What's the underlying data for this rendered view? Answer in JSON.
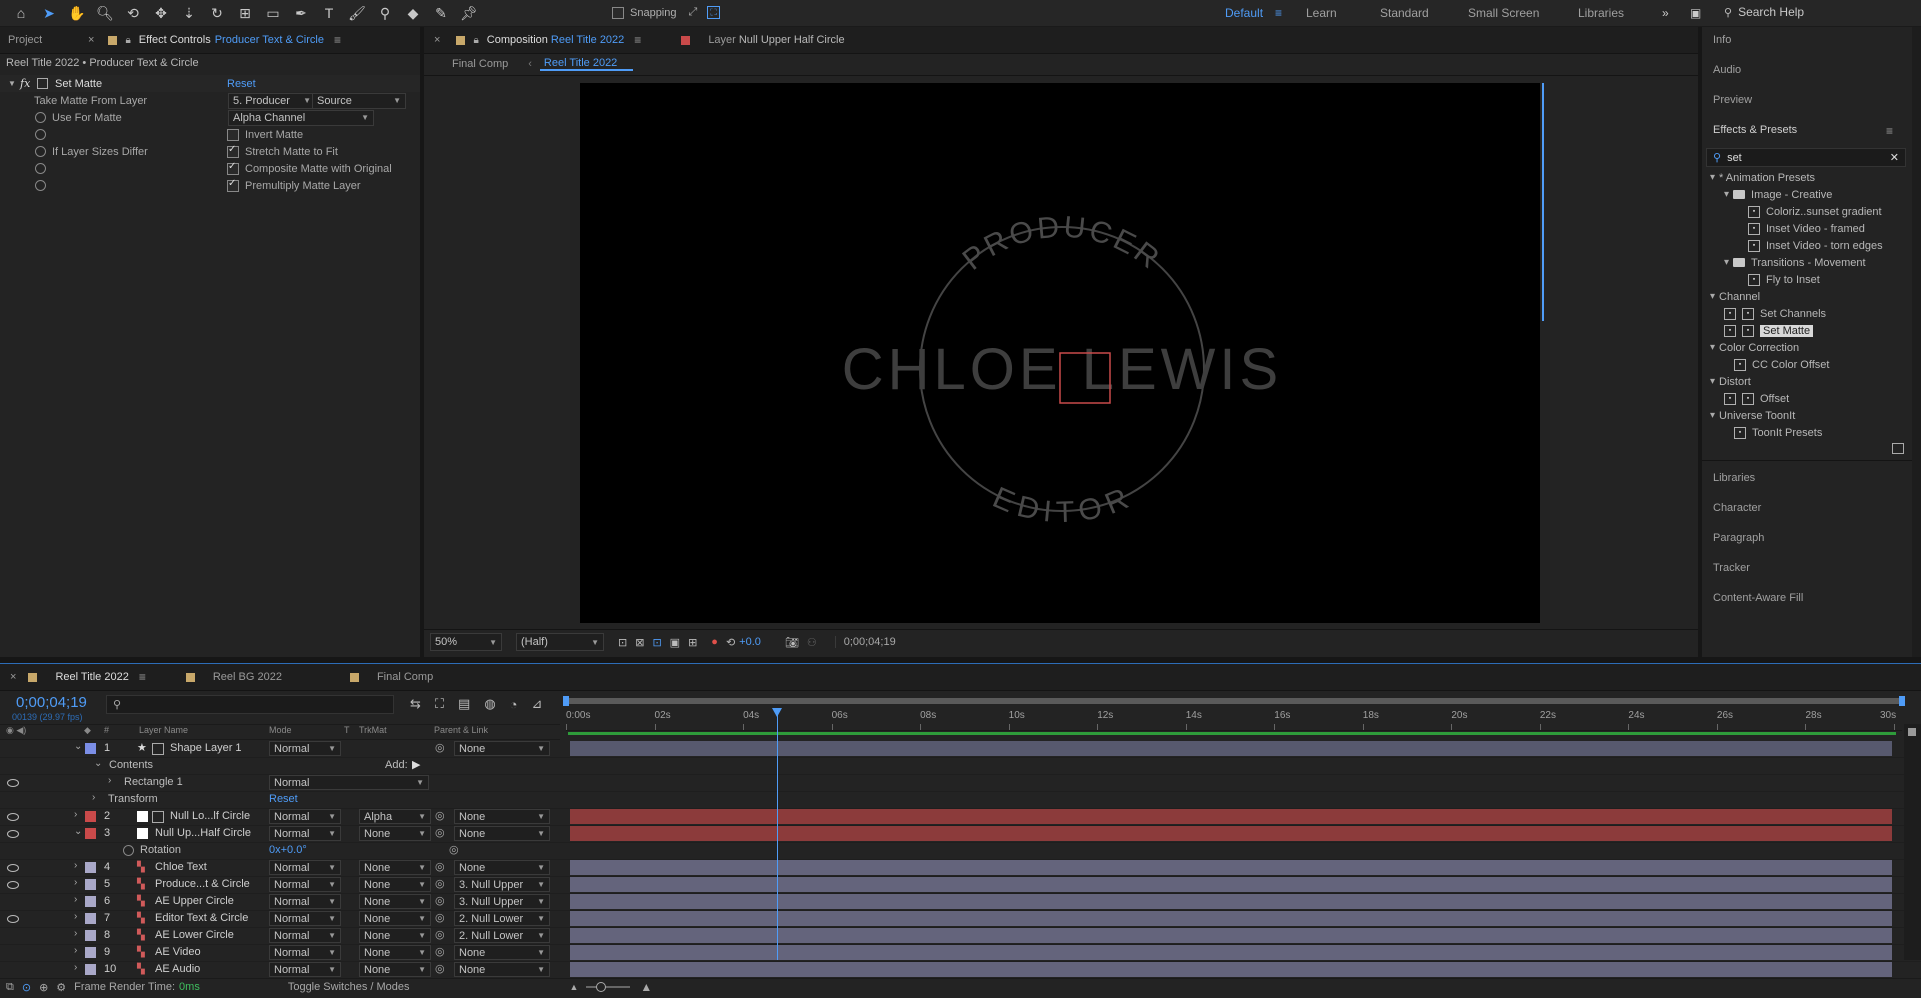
{
  "toolbar": {
    "snapping_label": "Snapping",
    "workspaces": [
      "Default",
      "Learn",
      "Standard",
      "Small Screen",
      "Libraries"
    ],
    "search_placeholder": "Search Help"
  },
  "left_panel": {
    "tabs": {
      "project": "Project",
      "effect_controls": "Effect Controls",
      "effect_layer": "Producer Text & Circle"
    },
    "breadcrumb": "Reel Title 2022 • Producer Text & Circle",
    "effect_name": "Set Matte",
    "reset": "Reset",
    "rows": {
      "take_matte": "Take Matte From Layer",
      "take_matte_value": "5. Producer",
      "take_matte_source": "Source",
      "use_for_matte": "Use For Matte",
      "use_for_matte_value": "Alpha Channel",
      "invert": "Invert Matte",
      "if_sizes": "If Layer Sizes Differ",
      "stretch": "Stretch Matte to Fit",
      "composite": "Composite Matte with Original",
      "premultiply": "Premultiply Matte Layer"
    }
  },
  "comp_panel": {
    "tab_prefix": "Composition",
    "tab_comp": "Reel Title 2022",
    "layer_prefix": "Layer",
    "layer_name": "Null Upper Half Circle",
    "crumb_1": "Final Comp",
    "crumb_2": "Reel Title 2022",
    "canvas": {
      "top_text": "PRODUCER",
      "center_text": "CHLOE LEWIS",
      "bottom_text": "EDITOR"
    },
    "zoom": "50%",
    "resolution": "(Half)",
    "exposure": "+0.0",
    "timecode": "0;00;04;19"
  },
  "right_panel": {
    "info": "Info",
    "audio": "Audio",
    "preview": "Preview",
    "effects_title": "Effects & Presets",
    "search_value": "set",
    "tree": [
      {
        "label": "* Animation Presets",
        "level": 0,
        "kind": "group"
      },
      {
        "label": "Image - Creative",
        "level": 1,
        "kind": "folder"
      },
      {
        "label": "Coloriz..sunset gradient",
        "level": 2,
        "kind": "fx"
      },
      {
        "label": "Inset Video - framed",
        "level": 2,
        "kind": "fx"
      },
      {
        "label": "Inset Video - torn edges",
        "level": 2,
        "kind": "fx"
      },
      {
        "label": "Transitions - Movement",
        "level": 1,
        "kind": "folder"
      },
      {
        "label": "Fly to Inset",
        "level": 2,
        "kind": "fx"
      },
      {
        "label": "Channel",
        "level": 0,
        "kind": "group"
      },
      {
        "label": "Set Channels",
        "level": 1,
        "kind": "fx2"
      },
      {
        "label": "Set Matte",
        "level": 1,
        "kind": "fx2",
        "selected": true
      },
      {
        "label": "Color Correction",
        "level": 0,
        "kind": "group"
      },
      {
        "label": "CC Color Offset",
        "level": 1,
        "kind": "fx"
      },
      {
        "label": "Distort",
        "level": 0,
        "kind": "group"
      },
      {
        "label": "Offset",
        "level": 1,
        "kind": "fx2"
      },
      {
        "label": "Universe ToonIt",
        "level": 0,
        "kind": "group"
      },
      {
        "label": "ToonIt Presets",
        "level": 1,
        "kind": "fx"
      }
    ],
    "bottom_items": [
      "Libraries",
      "Character",
      "Paragraph",
      "Tracker",
      "Content-Aware Fill"
    ]
  },
  "timeline": {
    "tabs": [
      "Reel Title 2022",
      "Reel BG 2022",
      "Final Comp"
    ],
    "timecode": "0;00;04;19",
    "frames": "00139 (29.97 fps)",
    "ruler": [
      "0:00s",
      "02s",
      "04s",
      "06s",
      "08s",
      "10s",
      "12s",
      "14s",
      "16s",
      "18s",
      "20s",
      "22s",
      "24s",
      "26s",
      "28s",
      "30s"
    ],
    "headers": {
      "num": "#",
      "name": "Layer Name",
      "mode": "Mode",
      "t": "T",
      "trkmat": "TrkMat",
      "parent": "Parent & Link"
    },
    "contents": "Contents",
    "add": "Add:",
    "rect": "Rectangle 1",
    "rect_mode": "Normal",
    "transform": "Transform",
    "transform_reset": "Reset",
    "rotation": "Rotation",
    "rotation_value": "0x+0.0°",
    "layers": [
      {
        "num": "1",
        "name": "Shape Layer 1",
        "mode": "Normal",
        "trkmat": "",
        "parent": "None",
        "color": "#7b8ee6",
        "eye": false,
        "bar": "#57596e"
      },
      {
        "num": "2",
        "name": "Null Lo...lf Circle",
        "mode": "Normal",
        "trkmat": "Alpha",
        "parent": "None",
        "color": "#c94a4a",
        "eye": true,
        "bar": "#8c3b3b"
      },
      {
        "num": "3",
        "name": "Null Up...Half Circle",
        "mode": "Normal",
        "trkmat": "None",
        "parent": "None",
        "color": "#c94a4a",
        "eye": true,
        "bar": "#8c3b3b"
      },
      {
        "num": "4",
        "name": "Chloe Text",
        "mode": "Normal",
        "trkmat": "None",
        "parent": "None",
        "color": "#a9a8c8",
        "eye": true,
        "bar": "#64647c"
      },
      {
        "num": "5",
        "name": "Produce...t & Circle",
        "mode": "Normal",
        "trkmat": "None",
        "parent": "3. Null Upper",
        "color": "#a9a8c8",
        "eye": true,
        "bar": "#64647c"
      },
      {
        "num": "6",
        "name": "AE Upper Circle",
        "mode": "Normal",
        "trkmat": "None",
        "parent": "3. Null Upper",
        "color": "#a9a8c8",
        "eye": false,
        "bar": "#64647c"
      },
      {
        "num": "7",
        "name": "Editor Text & Circle",
        "mode": "Normal",
        "trkmat": "None",
        "parent": "2. Null Lower",
        "color": "#a9a8c8",
        "eye": true,
        "bar": "#64647c"
      },
      {
        "num": "8",
        "name": "AE Lower Circle",
        "mode": "Normal",
        "trkmat": "None",
        "parent": "2. Null Lower",
        "color": "#a9a8c8",
        "eye": false,
        "bar": "#64647c"
      },
      {
        "num": "9",
        "name": "AE Video",
        "mode": "Normal",
        "trkmat": "None",
        "parent": "None",
        "color": "#a9a8c8",
        "eye": false,
        "bar": "#64647c"
      },
      {
        "num": "10",
        "name": "AE Audio",
        "mode": "Normal",
        "trkmat": "None",
        "parent": "None",
        "color": "#a9a8c8",
        "eye": false,
        "bar": "#64647c"
      }
    ],
    "footer": {
      "render_label": "Frame Render Time:",
      "render_value": "0ms",
      "toggle": "Toggle Switches / Modes"
    },
    "playhead_fraction": 0.1577
  }
}
